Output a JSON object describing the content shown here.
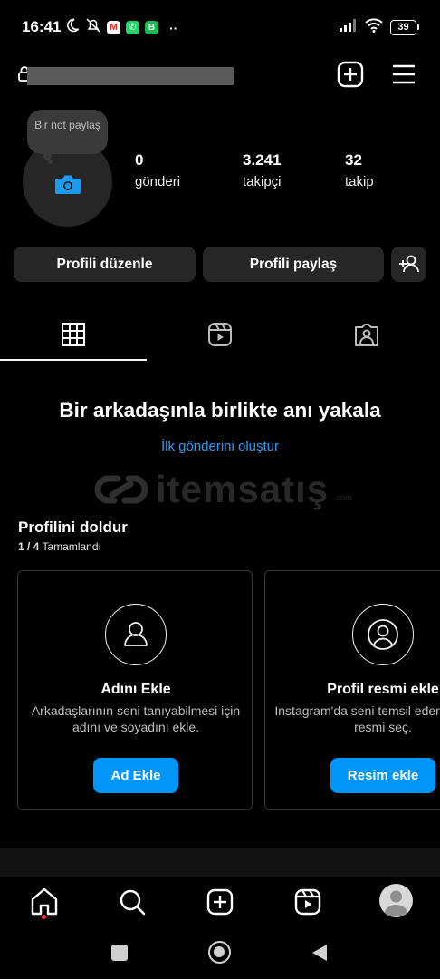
{
  "status_bar": {
    "time": "16:41",
    "battery": "39",
    "left_icons": [
      "moon-icon",
      "mute-icon",
      "gmail-icon",
      "whatsapp-icon",
      "app-icon",
      "more-icon"
    ],
    "right_icons": [
      "signal-icon",
      "wifi-icon",
      "battery-icon"
    ]
  },
  "top_bar": {
    "username_redacted": true,
    "icons": [
      "lock-icon",
      "create-icon",
      "menu-icon"
    ]
  },
  "profile": {
    "note_text": "Bir not paylaş",
    "stats": [
      {
        "value": "0",
        "label": "gönderi"
      },
      {
        "value": "3.241",
        "label": "takipçi"
      },
      {
        "value": "32",
        "label": "takip"
      }
    ],
    "edit_button": "Profili düzenle",
    "share_button": "Profili paylaş"
  },
  "tabs": [
    "grid-icon",
    "reels-icon",
    "tagged-icon"
  ],
  "empty_state": {
    "headline": "Bir arkadaşınla birlikte anı yakala",
    "link": "İlk gönderini oluştur"
  },
  "watermark": {
    "text": "itemsatış",
    "suffix": ".com"
  },
  "complete_profile": {
    "title": "Profilini doldur",
    "progress_count": "1 / 4",
    "progress_label": "Tamamlandı",
    "cards": [
      {
        "title": "Adını Ekle",
        "desc": "Arkadaşlarının seni tanıyabilmesi için adını ve soyadını ekle.",
        "button": "Ad Ekle"
      },
      {
        "title": "Profil resmi ekle",
        "desc": "Instagram'da seni temsil eden bir profil resmi seç.",
        "button": "Resim ekle"
      }
    ]
  },
  "bottom_nav": [
    "home-icon",
    "search-icon",
    "create-icon",
    "reels-icon",
    "profile-avatar"
  ],
  "colors": {
    "background": "#000000",
    "button_bg": "#262626",
    "accent_blue": "#0095f6",
    "link_blue": "#2e9bf0",
    "notification_red": "#ff3040"
  }
}
